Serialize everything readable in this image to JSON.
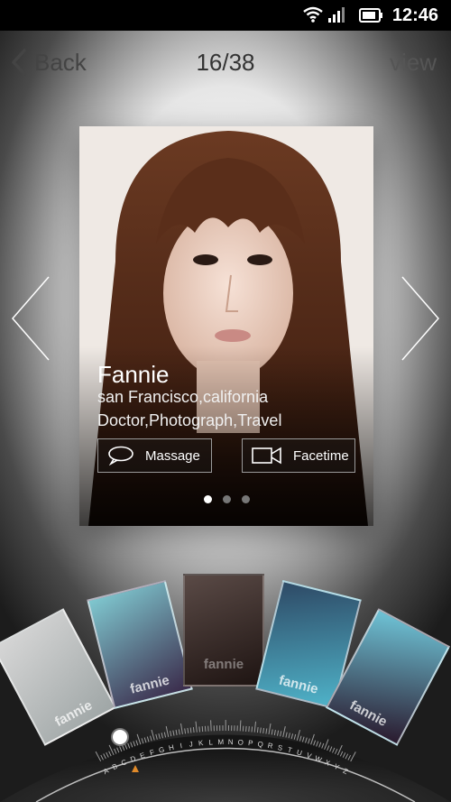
{
  "status": {
    "time": "12:46"
  },
  "header": {
    "back_label": "Back",
    "counter": "16/38",
    "view_label": "view"
  },
  "profile": {
    "name": "Fannie",
    "location": "san Francisco,california",
    "interests": "Doctor,Photograph,Travel",
    "message_label": "Massage",
    "facetime_label": "Facetime",
    "dots": {
      "count": 3,
      "active": 0
    }
  },
  "thumbnails": [
    "fannie",
    "fannie",
    "fannie",
    "fannie",
    "fannie"
  ],
  "dial_letters": [
    "A",
    "B",
    "C",
    "D",
    "E",
    "F",
    "G",
    "H",
    "I",
    "J",
    "K",
    "L",
    "M",
    "N",
    "O",
    "P",
    "Q",
    "R",
    "S",
    "T",
    "U",
    "V",
    "W",
    "X",
    "Y",
    "Z"
  ]
}
